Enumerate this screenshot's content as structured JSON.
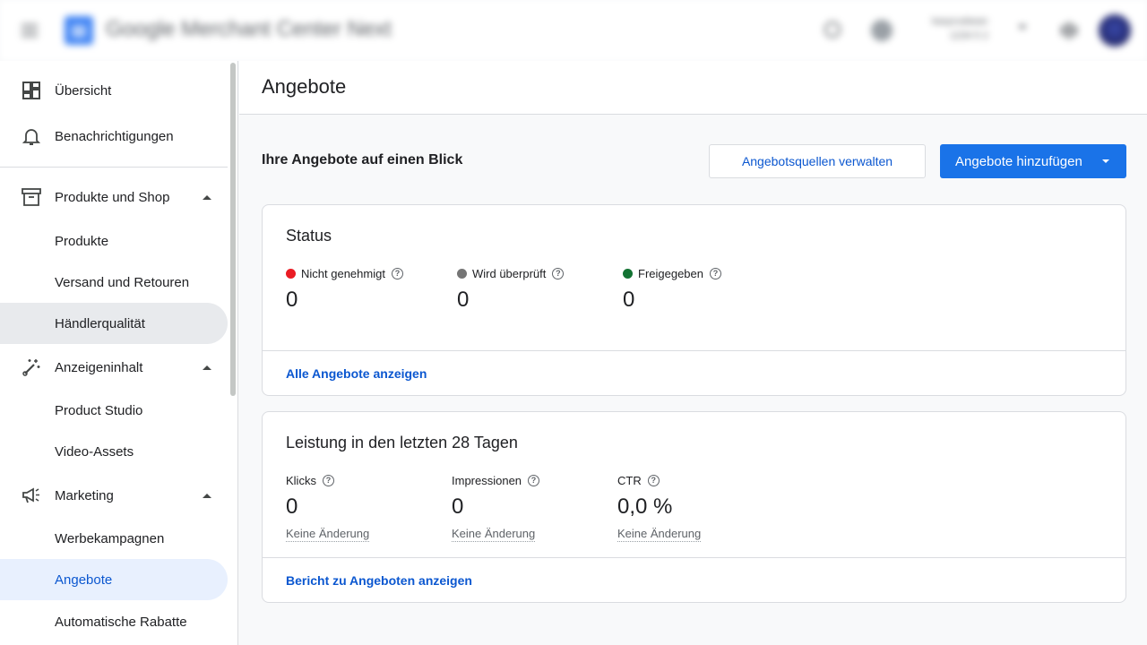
{
  "header": {
    "app_title": "Google Merchant Center Next",
    "account_name": "kasyrusbean",
    "account_id": "1234 5 2",
    "avatar_color": "#3949ab"
  },
  "sidebar": {
    "items": [
      {
        "label": "Übersicht",
        "icon": "dashboard-icon"
      },
      {
        "label": "Benachrichtigungen",
        "icon": "bell-icon"
      },
      {
        "label": "Produkte und Shop",
        "icon": "archive-icon"
      },
      {
        "label": "Produkte"
      },
      {
        "label": "Versand und Retouren"
      },
      {
        "label": "Händlerqualität"
      },
      {
        "label": "Anzeigeninhalt",
        "icon": "magic-wand-icon"
      },
      {
        "label": "Product Studio"
      },
      {
        "label": "Video-Assets"
      },
      {
        "label": "Marketing",
        "icon": "megaphone-icon"
      },
      {
        "label": "Werbekampagnen"
      },
      {
        "label": "Angebote"
      },
      {
        "label": "Automatische Rabatte"
      }
    ]
  },
  "page": {
    "title": "Angebote",
    "section_title": "Ihre Angebote auf einen Blick",
    "manage_sources_label": "Angebotsquellen verwalten",
    "add_offers_label": "Angebote hinzufügen"
  },
  "status_card": {
    "title": "Status",
    "metrics": [
      {
        "label": "Nicht genehmigt",
        "value": "0",
        "color": "#ea1c24"
      },
      {
        "label": "Wird überprüft",
        "value": "0",
        "color": "#757575"
      },
      {
        "label": "Freigegeben",
        "value": "0",
        "color": "#137333"
      }
    ],
    "link_label": "Alle Angebote anzeigen"
  },
  "performance_card": {
    "title": "Leistung in den letzten 28 Tagen",
    "metrics": [
      {
        "label": "Klicks",
        "value": "0",
        "change": "Keine Änderung"
      },
      {
        "label": "Impressionen",
        "value": "0",
        "change": "Keine Änderung"
      },
      {
        "label": "CTR",
        "value": "0,0 %",
        "change": "Keine Änderung"
      }
    ],
    "link_label": "Bericht zu Angeboten anzeigen"
  },
  "colors": {
    "accent": "#1a73e8",
    "link": "#0b57d0",
    "active_nav_bg": "#e8f0fe"
  }
}
